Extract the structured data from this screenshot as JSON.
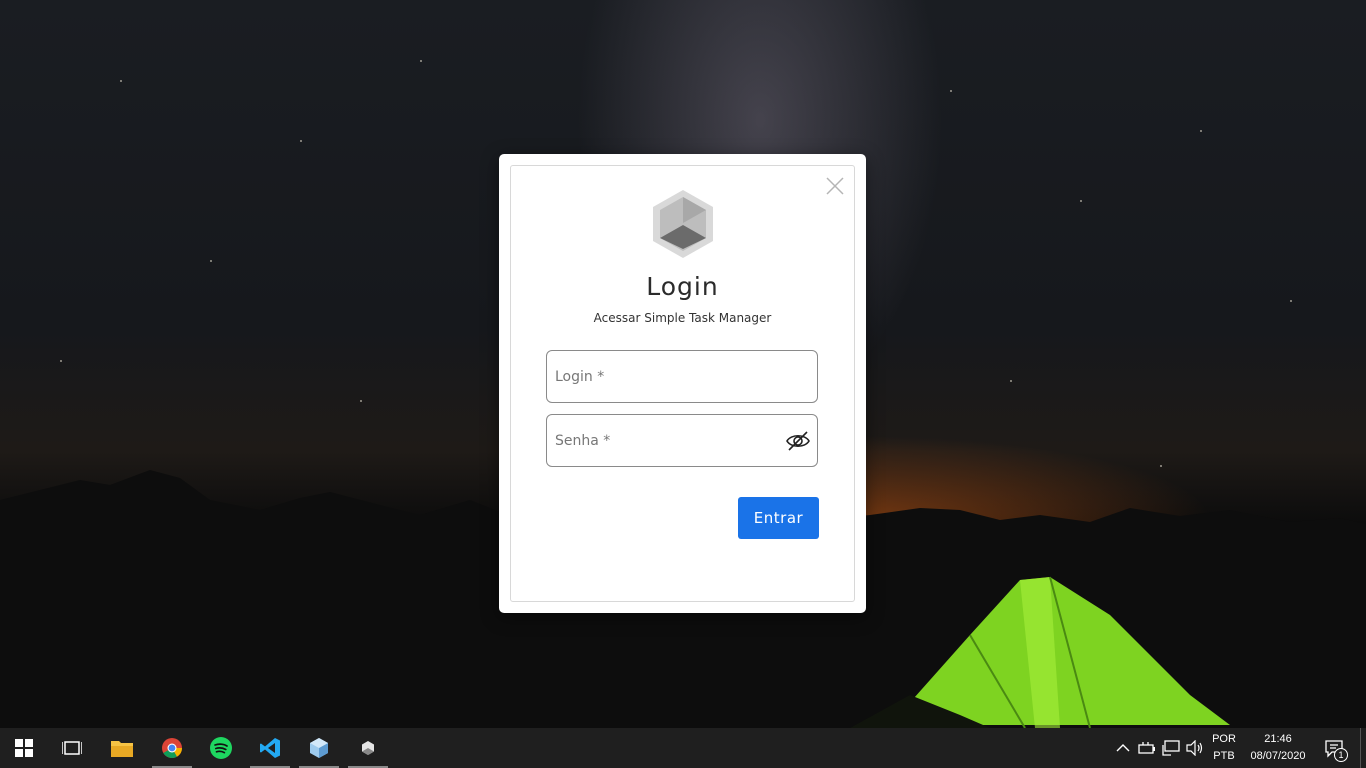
{
  "dialog": {
    "title": "Login",
    "subtitle": "Acessar Simple Task Manager",
    "login_placeholder": "Login *",
    "password_placeholder": "Senha *",
    "submit_label": "Entrar"
  },
  "taskbar": {
    "apps": [
      {
        "name": "Windows Start",
        "icon": "windows-logo-icon"
      },
      {
        "name": "Task View",
        "icon": "task-view-icon"
      },
      {
        "name": "File Explorer",
        "icon": "folder-icon"
      },
      {
        "name": "Google Chrome",
        "icon": "chrome-icon"
      },
      {
        "name": "Spotify",
        "icon": "spotify-icon"
      },
      {
        "name": "Visual Studio Code",
        "icon": "vscode-icon"
      },
      {
        "name": "Cube App",
        "icon": "cube-icon"
      },
      {
        "name": "Simple Task Manager",
        "icon": "hexagon-icon"
      }
    ],
    "language_top": "POR",
    "language_bottom": "PTB",
    "time": "21:46",
    "date": "08/07/2020",
    "notification_count": "1"
  },
  "colors": {
    "accent": "#1a73e8",
    "taskbar": "#1f1f1f",
    "tent_green": "#7ed321"
  }
}
